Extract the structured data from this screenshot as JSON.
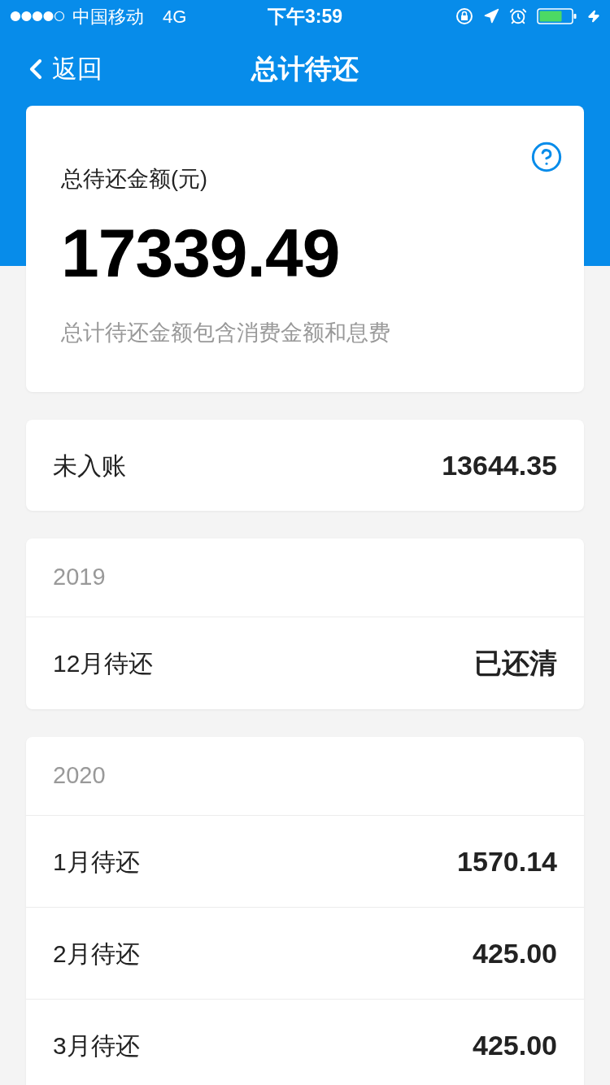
{
  "status_bar": {
    "carrier": "中国移动",
    "network": "4G",
    "time": "下午3:59"
  },
  "nav": {
    "back": "返回",
    "title": "总计待还"
  },
  "summary": {
    "label": "总待还金额(元)",
    "amount": "17339.49",
    "note": "总计待还金额包含消费金额和息费"
  },
  "unbilled": {
    "label": "未入账",
    "value": "13644.35"
  },
  "groups": [
    {
      "year": "2019",
      "rows": [
        {
          "label": "12月待还",
          "value": "已还清"
        }
      ]
    },
    {
      "year": "2020",
      "rows": [
        {
          "label": "1月待还",
          "value": "1570.14"
        },
        {
          "label": "2月待还",
          "value": "425.00"
        },
        {
          "label": "3月待还",
          "value": "425.00"
        }
      ]
    }
  ]
}
